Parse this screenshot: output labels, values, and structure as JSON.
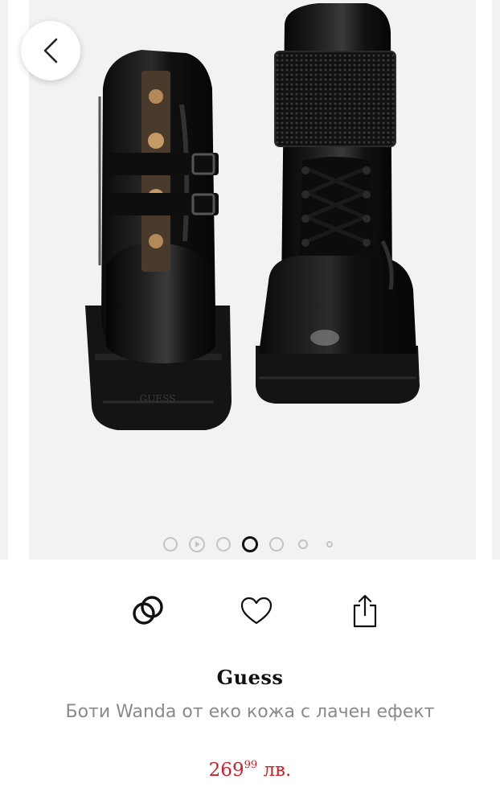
{
  "product": {
    "brand": "Guess",
    "title": "Боти Wanda от еко кожа с лачен ефект",
    "price": {
      "whole": "269",
      "cents": "99",
      "currency": "лв."
    }
  },
  "image": {
    "logo_text": "GUESS"
  },
  "gallery": {
    "active_index": 3,
    "dots": [
      {
        "kind": "normal"
      },
      {
        "kind": "video"
      },
      {
        "kind": "normal"
      },
      {
        "kind": "active"
      },
      {
        "kind": "normal"
      },
      {
        "kind": "small"
      },
      {
        "kind": "tiny"
      }
    ]
  },
  "icons": {
    "back": "chevron-left-icon",
    "compare": "compare-rings-icon",
    "favorite": "heart-icon",
    "share": "share-icon"
  },
  "colors": {
    "price": "#d0202a",
    "dot_inactive": "#c4c4c4",
    "dot_active": "#111111"
  }
}
